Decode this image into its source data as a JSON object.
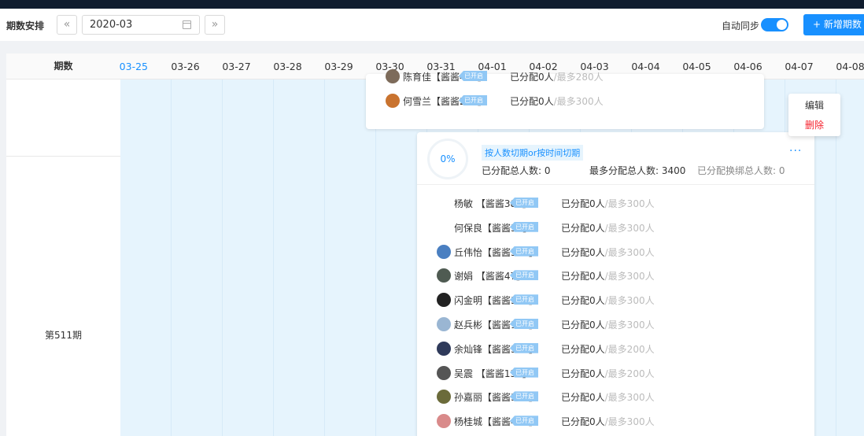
{
  "toolbar": {
    "title": "期数安排",
    "prev_btn": "«",
    "next_btn": "»",
    "month_value": "2020-03",
    "sync_label": "自动同步",
    "sync_on": true,
    "add_label": "+ 新增期数"
  },
  "header": {
    "period_col": "期数",
    "days": [
      "03-25",
      "03-26",
      "03-27",
      "03-28",
      "03-29",
      "03-30",
      "03-31",
      "04-01",
      "04-02",
      "04-03",
      "04-04",
      "04-05",
      "04-06",
      "04-07",
      "04-08"
    ],
    "today": "03-25"
  },
  "periods": [
    {
      "label": "",
      "members": [
        {
          "name": "陈育佳【酱酱486】",
          "tag": "已开启",
          "assigned": "已分配0人",
          "max": "/最多280人",
          "avatar": "#7d6b5a"
        },
        {
          "name": "何雪兰【酱酱234】",
          "tag": "已开启",
          "assigned": "已分配0人",
          "max": "/最多300人",
          "avatar": "#c9732f"
        }
      ]
    },
    {
      "label": "第511期",
      "progress": "0%",
      "mode": "按人数切期or按时间切期",
      "stats": {
        "assigned_total": "已分配总人数: 0",
        "max_total": "最多分配总人数: 3400",
        "bound_total": "已分配换绑总人数: 0"
      },
      "members": [
        {
          "name": "杨敏  【酱酱389】",
          "tag": "已开启",
          "assigned": "已分配0人",
          "max": "/最多300人",
          "avatar": ""
        },
        {
          "name": "何保良【酱酱51】",
          "tag": "已开启",
          "assigned": "已分配0人",
          "max": "/最多300人",
          "avatar": ""
        },
        {
          "name": "丘伟怡【酱酱503】",
          "tag": "已开启",
          "assigned": "已分配0人",
          "max": "/最多300人",
          "avatar": "#4a7fc1"
        },
        {
          "name": "谢娟  【酱酱47】",
          "tag": "已开启",
          "assigned": "已分配0人",
          "max": "/最多300人",
          "avatar": "#4f5b52"
        },
        {
          "name": "闪金明【酱酱362】",
          "tag": "已开启",
          "assigned": "已分配0人",
          "max": "/最多300人",
          "avatar": "#222222"
        },
        {
          "name": "赵兵彬【酱酱101】",
          "tag": "已开启",
          "assigned": "已分配0人",
          "max": "/最多300人",
          "avatar": "#9ab6d3"
        },
        {
          "name": "余灿锋【酱酱390】",
          "tag": "已开启",
          "assigned": "已分配0人",
          "max": "/最多200人",
          "avatar": "#2f3a5a"
        },
        {
          "name": "吴震  【酱酱130】",
          "tag": "已开启",
          "assigned": "已分配0人",
          "max": "/最多200人",
          "avatar": "#555555"
        },
        {
          "name": "孙嘉丽【酱酱336】",
          "tag": "已开启",
          "assigned": "已分配0人",
          "max": "/最多300人",
          "avatar": "#6b6b3a"
        },
        {
          "name": "杨桂城【酱酱434】",
          "tag": "已开启",
          "assigned": "已分配0人",
          "max": "/最多300人",
          "avatar": "#d98a8a"
        }
      ]
    }
  ],
  "context_menu": {
    "edit": "编辑",
    "delete": "删除"
  },
  "colors": {
    "accent": "#1890ff",
    "day_bg": "#e6f4fd",
    "danger": "#f5222d"
  }
}
